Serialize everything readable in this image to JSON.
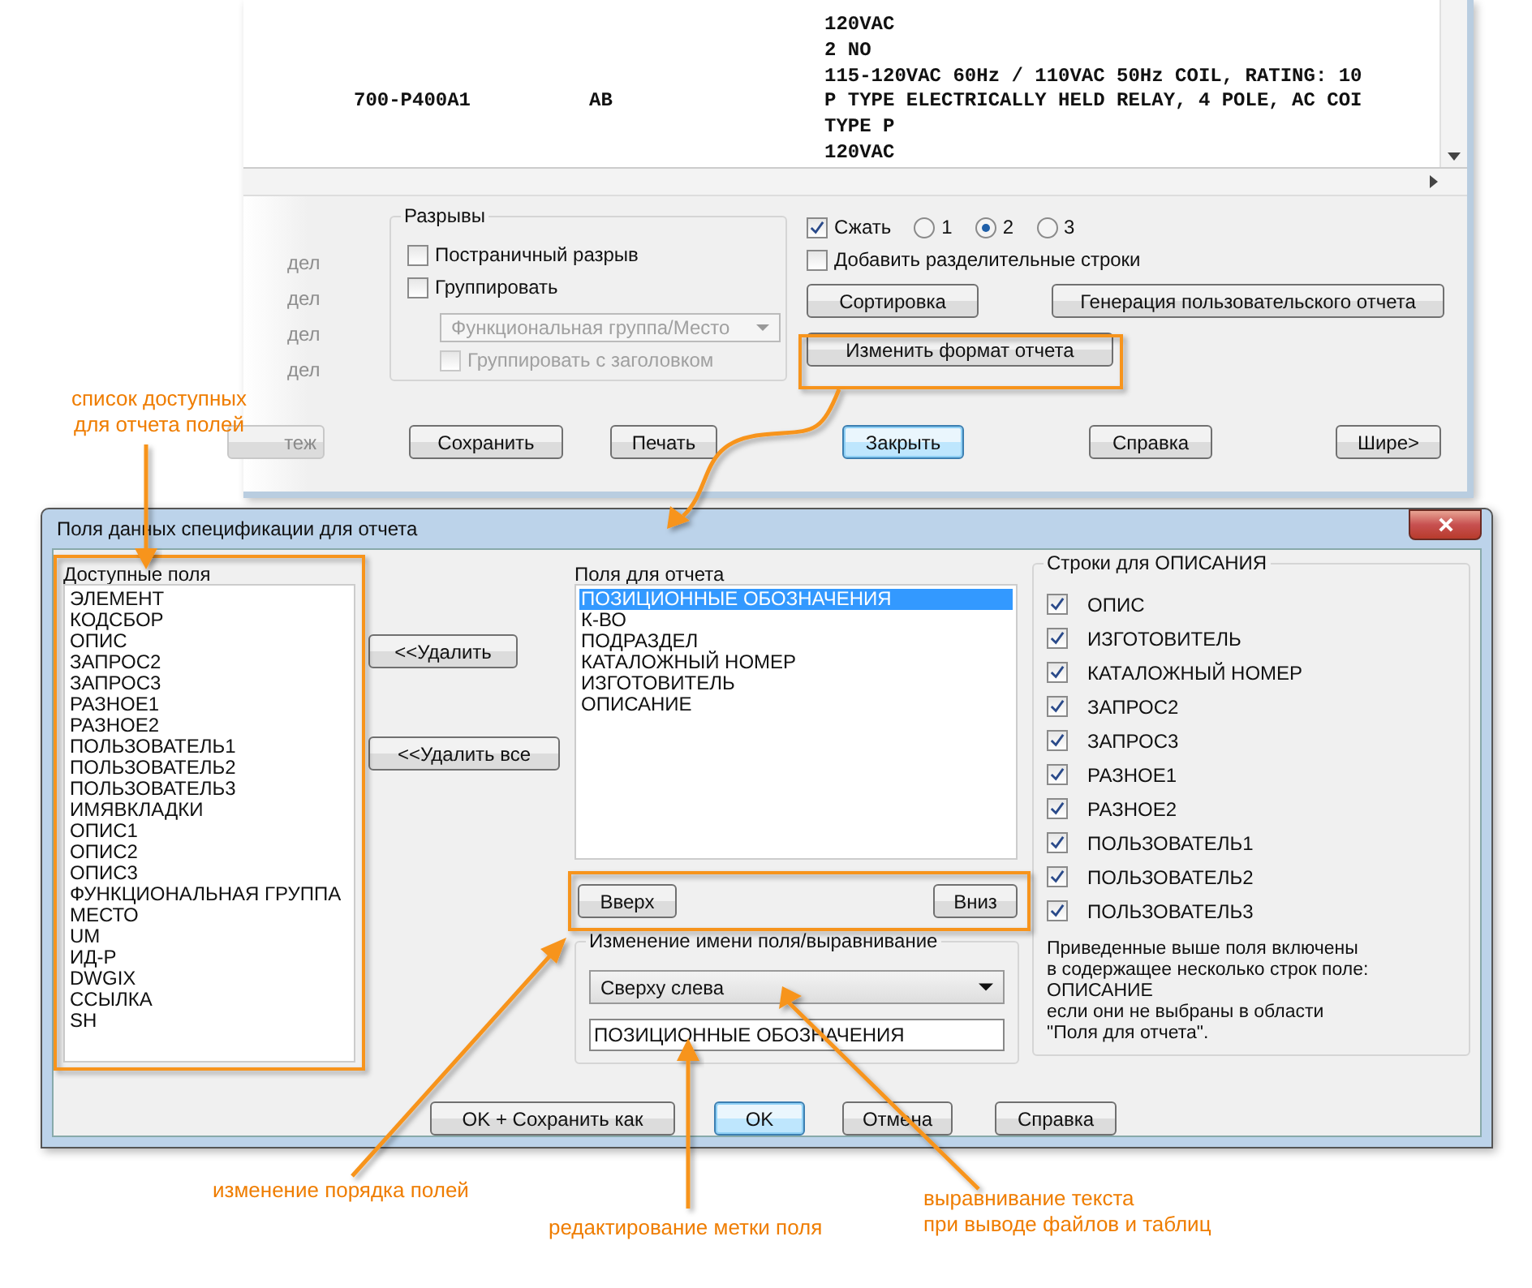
{
  "report_window": {
    "listing": {
      "rows": [
        {
          "column_3": "120VAC"
        },
        {
          "column_3": "2 NO"
        },
        {
          "column_3": "115-120VAC 60Hz / 110VAC 50Hz COIL, RATING: 10"
        },
        {
          "column_1": "700-P400A1",
          "column_2": "AB",
          "column_3": "P TYPE ELECTRICALLY HELD RELAY, 4 POLE, AC COI"
        },
        {
          "column_3": "TYPE P"
        },
        {
          "column_3": "120VAC"
        }
      ]
    },
    "faded_labels": [
      "дел",
      "дел",
      "дел",
      "дел"
    ],
    "breaks": {
      "title": "Разрывы",
      "options": [
        {
          "label": "Постраничный разрыв",
          "checked": false
        },
        {
          "label": "Группировать",
          "checked": false
        }
      ],
      "group_by": {
        "value": "Функциональная группа/Место",
        "disabled": true
      },
      "group_with_header": {
        "label": "Группировать с заголовком",
        "checked": false,
        "disabled": true
      }
    },
    "compress": {
      "label": "Сжать",
      "checked": true
    },
    "compress_levels": [
      {
        "label": "1",
        "selected": false
      },
      {
        "label": "2",
        "selected": true
      },
      {
        "label": "3",
        "selected": false
      }
    ],
    "separator_rows": {
      "label": "Добавить разделительные строки",
      "checked": false
    },
    "sort_button": "Сортировка",
    "custom_report_button": "Генерация пользовательского отчета",
    "change_format_button": "Изменить формат отчета",
    "bottom_buttons": [
      {
        "label": "теж",
        "default": false,
        "disabled": true
      },
      {
        "label": "Сохранить",
        "default": false,
        "disabled": false
      },
      {
        "label": "Печать",
        "default": false,
        "disabled": false
      },
      {
        "label": "Закрыть",
        "default": true,
        "disabled": false
      },
      {
        "label": "Справка",
        "default": false,
        "disabled": false
      },
      {
        "label": "Шире>",
        "default": false,
        "disabled": false
      }
    ]
  },
  "dialog": {
    "title": "Поля данных спецификации для отчета",
    "available_fields": {
      "label": "Доступные поля",
      "items": [
        "ЭЛЕМЕНТ",
        "КОДСБОР",
        "ОПИС",
        "ЗАПРОС2",
        "ЗАПРОС3",
        "РАЗНОЕ1",
        "РАЗНОЕ2",
        "ПОЛЬЗОВАТЕЛЬ1",
        "ПОЛЬЗОВАТЕЛЬ2",
        "ПОЛЬЗОВАТЕЛЬ3",
        "ИМЯВКЛАДКИ",
        "ОПИС1",
        "ОПИС2",
        "ОПИС3",
        "ФУНКЦИОНАЛЬНАЯ ГРУППА",
        "МЕСТО",
        "UM",
        "ИД-Р",
        "DWGIX",
        "ССЫЛКА",
        "SH"
      ]
    },
    "remove_button": "<<Удалить",
    "remove_all_button": "<<Удалить все",
    "report_fields": {
      "label": "Поля для отчета",
      "items": [
        {
          "text": "ПОЗИЦИОННЫЕ ОБОЗНАЧЕНИЯ",
          "selected": true
        },
        {
          "text": "К-ВО",
          "selected": false
        },
        {
          "text": "ПОДРАЗДЕЛ",
          "selected": false
        },
        {
          "text": "КАТАЛОЖНЫЙ НОМЕР",
          "selected": false
        },
        {
          "text": "ИЗГОТОВИТЕЛЬ",
          "selected": false
        },
        {
          "text": "ОПИСАНИЕ",
          "selected": false
        }
      ]
    },
    "up_button": "Вверх",
    "down_button": "Вниз",
    "rename": {
      "title": "Изменение имени поля/выравнивание",
      "alignment": "Сверху слева",
      "name": "ПОЗИЦИОННЫЕ ОБОЗНАЧЕНИЯ"
    },
    "description_rows": {
      "title": "Строки для ОПИСАНИЯ",
      "items": [
        {
          "label": "ОПИС",
          "checked": true
        },
        {
          "label": "ИЗГОТОВИТЕЛЬ",
          "checked": true
        },
        {
          "label": "КАТАЛОЖНЫЙ НОМЕР",
          "checked": true
        },
        {
          "label": "ЗАПРОС2",
          "checked": true
        },
        {
          "label": "ЗАПРОС3",
          "checked": true
        },
        {
          "label": "РАЗНОЕ1",
          "checked": true
        },
        {
          "label": "РАЗНОЕ2",
          "checked": true
        },
        {
          "label": "ПОЛЬЗОВАТЕЛЬ1",
          "checked": true
        },
        {
          "label": "ПОЛЬЗОВАТЕЛЬ2",
          "checked": true
        },
        {
          "label": "ПОЛЬЗОВАТЕЛЬ3",
          "checked": true
        }
      ],
      "note": "Приведенные выше поля включены\nв содержащее несколько строк поле:\nОПИСАНИЕ\nесли они не выбраны в области\n\"Поля для отчета\"."
    },
    "buttons": [
      {
        "label": "OK + Сохранить как",
        "default": false
      },
      {
        "label": "OK",
        "default": true
      },
      {
        "label": "Отмена",
        "default": false
      },
      {
        "label": "Справка",
        "default": false
      }
    ]
  },
  "callouts": [
    {
      "text": "список доступных\nдля отчета полей",
      "kind": "centered"
    },
    {
      "text": "изменение порядка полей",
      "kind": "left"
    },
    {
      "text": "редактирование метки поля",
      "kind": "left"
    },
    {
      "text": "выравнивание текста\nпри выводе файлов и таблиц",
      "kind": "left"
    }
  ]
}
